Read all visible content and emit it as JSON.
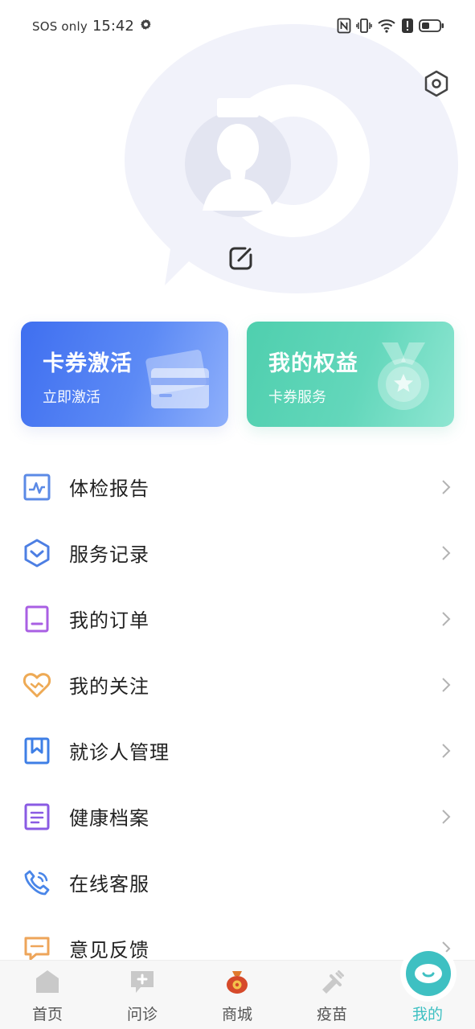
{
  "status_bar": {
    "carrier": "SOS only",
    "time": "15:42"
  },
  "profile": {
    "settings_icon": "hexagon-settings-icon",
    "avatar_icon": "default-avatar-icon",
    "edit_icon": "edit-icon"
  },
  "cards": [
    {
      "title": "卡券激活",
      "subtitle": "立即激活",
      "color": "#4A7BF2",
      "icon": "card-icon"
    },
    {
      "title": "我的权益",
      "subtitle": "卡券服务",
      "color": "#55D2B3",
      "icon": "medal-icon"
    }
  ],
  "menu": [
    {
      "label": "体检报告",
      "icon": "report-icon",
      "chevron": true
    },
    {
      "label": "服务记录",
      "icon": "service-record-icon",
      "chevron": true
    },
    {
      "label": "我的订单",
      "icon": "order-icon",
      "chevron": true
    },
    {
      "label": "我的关注",
      "icon": "heart-icon",
      "chevron": true
    },
    {
      "label": "就诊人管理",
      "icon": "bookmark-icon",
      "chevron": true
    },
    {
      "label": "健康档案",
      "icon": "file-icon",
      "chevron": true
    },
    {
      "label": "在线客服",
      "icon": "phone-icon",
      "chevron": false
    },
    {
      "label": "意见反馈",
      "icon": "feedback-icon",
      "chevron": true
    }
  ],
  "bottom_nav": [
    {
      "label": "首页",
      "icon": "home-icon",
      "active": false
    },
    {
      "label": "问诊",
      "icon": "consult-icon",
      "active": false
    },
    {
      "label": "商城",
      "icon": "mall-icon",
      "active": false
    },
    {
      "label": "疫苗",
      "icon": "vaccine-icon",
      "active": false
    },
    {
      "label": "我的",
      "icon": "mine-icon",
      "active": true
    }
  ],
  "colors": {
    "accent": "#3EC0C2",
    "card_blue": "#4A7BF2",
    "card_green": "#55D2B3"
  }
}
